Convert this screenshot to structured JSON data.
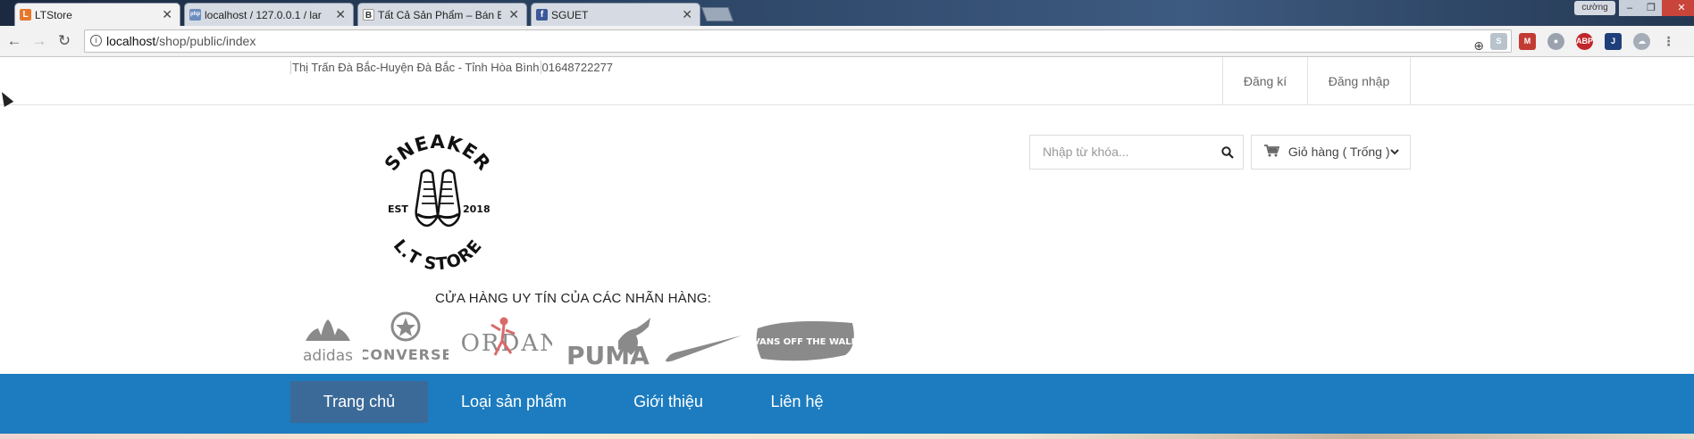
{
  "browser": {
    "tabs": [
      {
        "title": "LTStore",
        "active": true,
        "favicon_color": "#e8772a",
        "favicon_glyph": "L"
      },
      {
        "title": "localhost / 127.0.0.1 / lar",
        "active": false,
        "favicon_color": "#6c8ebf",
        "favicon_glyph": "php"
      },
      {
        "title": "Tất Cả Sản Phẩm – Bán B",
        "active": false,
        "favicon_color": "#333",
        "favicon_glyph": "B"
      },
      {
        "title": "SGUET",
        "active": false,
        "favicon_color": "#3b5998",
        "favicon_glyph": "f"
      }
    ],
    "profile_name": "cường",
    "url_host": "localhost",
    "url_path": "/shop/public/index"
  },
  "topbar": {
    "address": "Thị Trấn Đà Bắc-Huyện Đà Bắc - Tỉnh Hòa Bình",
    "phone": "01648722277",
    "register": "Đăng kí",
    "login": "Đăng nhập"
  },
  "logo": {
    "top_text": "SNEAKER",
    "est": "EST",
    "year": "2018",
    "bottom_text": "L.T STORE"
  },
  "search": {
    "placeholder": "Nhập từ khóa..."
  },
  "cart": {
    "label": "Giỏ hàng ( Trống )"
  },
  "brands": {
    "title": "CỬA HÀNG UY TÍN CỦA CÁC NHÃN HÀNG:",
    "items": [
      "adidas",
      "CONVERSE",
      "JORDAN",
      "PUMA",
      "nike",
      "VANS OFF THE WALL"
    ]
  },
  "nav": {
    "items": [
      "Trang chủ",
      "Loại sản phẩm",
      "Giới thiệu",
      "Liên hệ"
    ],
    "active_index": 0,
    "color": "#1c7cbf",
    "active_color": "#3b6a98"
  }
}
